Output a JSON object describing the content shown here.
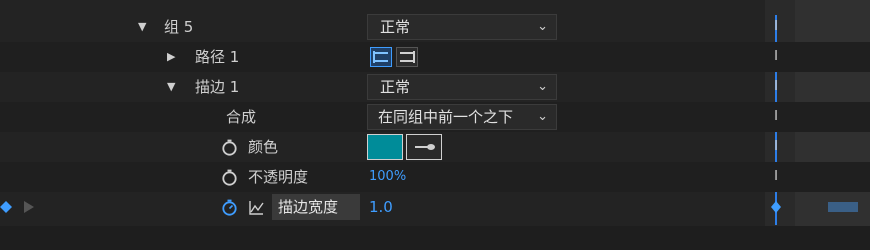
{
  "rows": {
    "group5": {
      "label": "组 5",
      "blend": "正常"
    },
    "path1": {
      "label": "路径 1"
    },
    "stroke1": {
      "label": "描边 1",
      "blend": "正常"
    },
    "composite": {
      "label": "合成",
      "value": "在同组中前一个之下"
    },
    "color": {
      "label": "颜色"
    },
    "opacity": {
      "label": "不透明度",
      "value": "100%"
    },
    "stroke_width": {
      "label": "描边宽度",
      "value": "1.0"
    }
  },
  "colors": {
    "accent": "#3f9dff",
    "swatch": "#008c99",
    "timeline": "#2d7ee8"
  },
  "icons": {
    "expand": "triangle-down-icon",
    "collapse": "triangle-right-icon",
    "stopwatch": "stopwatch-icon",
    "graph": "graph-icon",
    "keyframe": "diamond-icon"
  }
}
